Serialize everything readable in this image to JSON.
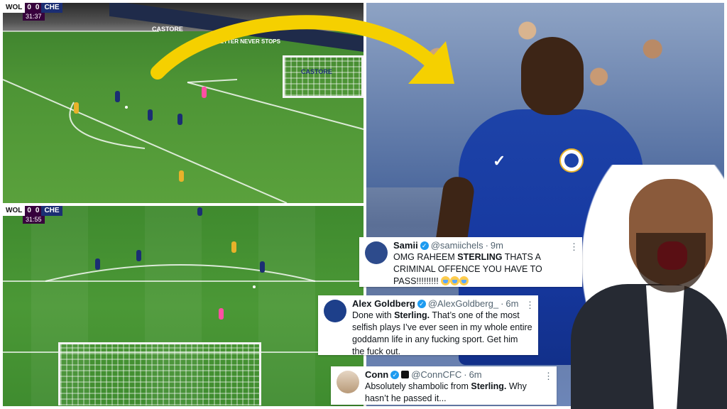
{
  "top_pitch": {
    "scorebug": {
      "home": "WOL",
      "home_score": "0",
      "away_score": "0",
      "away": "CHE",
      "clock": "31:37"
    },
    "ads": [
      "CASTORE",
      "BETTER NEVER STOPS",
      "CASTORE"
    ]
  },
  "bottom_pitch": {
    "scorebug": {
      "home": "WOL",
      "home_score": "0",
      "away_score": "0",
      "away": "CHE",
      "clock": "31:55"
    }
  },
  "tweets": [
    {
      "name": "Samii",
      "handle": "@samiichels",
      "time": "9m",
      "segments": [
        "OMG RAHEEM ",
        "STERLING",
        " THATS A CRIMINAL OFFENCE YOU HAVE TO PASS!!!!!!!!!"
      ],
      "more": "⋮"
    },
    {
      "name": "Alex Goldberg",
      "handle": "@AlexGoldberg_",
      "time": "6m",
      "segments": [
        "Done with ",
        "Sterling.",
        " That’s one of the most selfish plays I’ve ever seen in my whole entire goddamn life in any fucking sport. Get him the fuck out."
      ],
      "more": "⋮"
    },
    {
      "name": "Conn",
      "handle": "@ConnCFC",
      "time": "6m",
      "segments": [
        "Absolutely shambolic from ",
        "Sterling.",
        " Why hasn’t he passed it..."
      ],
      "more": "⋮"
    }
  ],
  "colors": {
    "arrow": "#f5d000",
    "chelsea_blue": "#1d43a8",
    "verified": "#1d9bf0",
    "pl_purple": "#37003c"
  },
  "icons": [
    "verified-badge-icon",
    "more-options-icon",
    "crying-emoji-icon",
    "nike-swoosh-icon",
    "chelsea-crest-icon"
  ]
}
